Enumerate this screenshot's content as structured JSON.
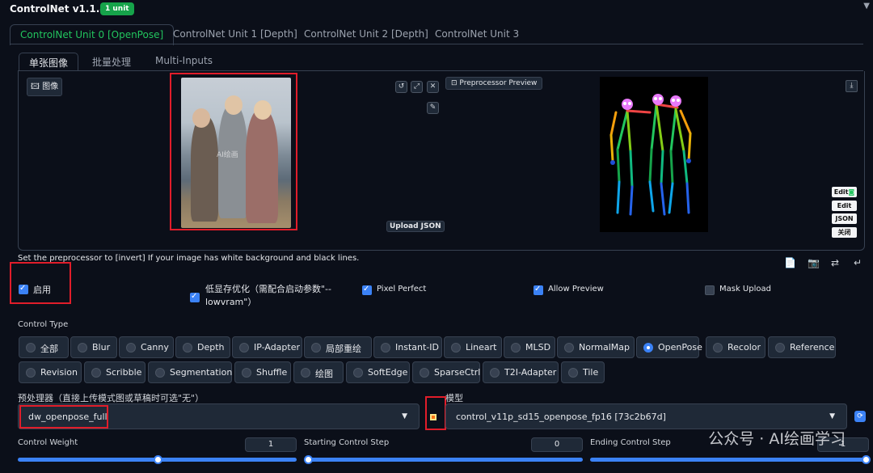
{
  "header": {
    "title": "ControlNet v1.1.445",
    "badge": "1 unit"
  },
  "unit_tabs": [
    {
      "label": "ControlNet Unit 0 [OpenPose]",
      "active": true
    },
    {
      "label": "ControlNet Unit 1 [Depth]",
      "active": false
    },
    {
      "label": "ControlNet Unit 2 [Depth]",
      "active": false
    },
    {
      "label": "ControlNet Unit 3",
      "active": false
    }
  ],
  "sub_tabs": [
    {
      "label": "单张图像",
      "active": true
    },
    {
      "label": "批量处理",
      "active": false
    },
    {
      "label": "Multi-Inputs",
      "active": false
    }
  ],
  "image_panel": {
    "image_label": "图像",
    "photo_watermark": "AI绘画",
    "preview_button": "Preprocessor Preview",
    "upload_json": "Upload JSON",
    "right_buttons": [
      "Edit",
      "Edit",
      "JSON",
      "关闭"
    ]
  },
  "hint": "Set the preprocessor to [invert] If your image has white background and black lines.",
  "options": {
    "enable": {
      "label": "启用",
      "checked": true
    },
    "lowvram": {
      "label": "低显存优化（需配合启动参数\"--lowvram\"）",
      "label_line1": "低显存优化（需配合启动参数\"--",
      "label_line2": "lowvram\"）",
      "checked": true
    },
    "pixel_perfect": {
      "label": "Pixel Perfect",
      "checked": true
    },
    "allow_preview": {
      "label": "Allow Preview",
      "checked": true
    },
    "mask_upload": {
      "label": "Mask Upload",
      "checked": false
    }
  },
  "control_type": {
    "label": "Control Type",
    "row1": [
      "全部",
      "Blur",
      "Canny",
      "Depth",
      "IP-Adapter",
      "局部重绘",
      "Instant-ID",
      "Lineart",
      "MLSD",
      "NormalMap",
      "OpenPose",
      "Recolor",
      "Reference"
    ],
    "row2": [
      "Revision",
      "Scribble",
      "Segmentation",
      "Shuffle",
      "绘图",
      "SoftEdge",
      "SparseCtrl",
      "T2I-Adapter",
      "Tile"
    ],
    "selected": "OpenPose"
  },
  "preprocessor": {
    "label": "预处理器（直接上传模式图或草稿时可选\"无\"）",
    "value": "dw_openpose_full"
  },
  "model": {
    "label": "模型",
    "value": "control_v11p_sd15_openpose_fp16 [73c2b67d]"
  },
  "sliders": {
    "control_weight": {
      "label": "Control Weight",
      "value": "1",
      "fraction": 0.46
    },
    "starting_step": {
      "label": "Starting Control Step",
      "value": "0",
      "fraction": 0.0
    },
    "ending_step": {
      "label": "Ending Control Step",
      "value": "1",
      "fraction": 1.0
    }
  },
  "watermark": "公众号 · AI绘画学习",
  "colors": {
    "accent": "#3b82f6",
    "active_tab": "#22c55e",
    "highlight": "#e11d2a",
    "background": "#0b0f19"
  }
}
